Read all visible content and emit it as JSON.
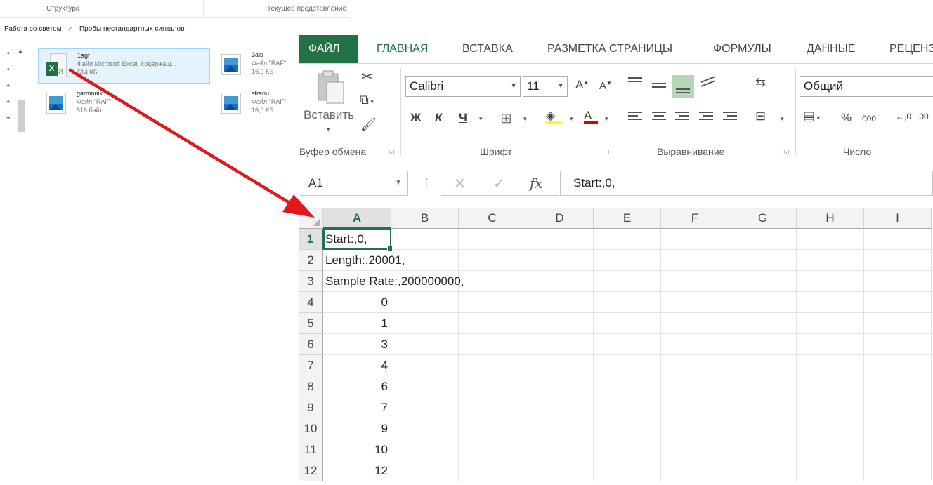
{
  "explorer": {
    "header": {
      "col1": "Структура",
      "col2": "Текущее представление"
    },
    "breadcrumb": [
      "Работа со светом",
      "Пробы нестандартных сигналов"
    ],
    "files": [
      {
        "name": "1agf",
        "type": "Файл Microsoft Excel, содержащ...",
        "size": "514 КБ",
        "icon": "excel-file-icon"
      },
      {
        "name": "3ais",
        "type": "Файл \"RAF\"",
        "size": "16,0 КБ",
        "icon": "image-file-icon"
      },
      {
        "name": "garmonik",
        "type": "Файл \"RAF\"",
        "size": "516 байт",
        "icon": "image-file-icon"
      },
      {
        "name": "stranu",
        "type": "Файл \"RAF\"",
        "size": "16,0 КБ",
        "icon": "image-file-icon"
      }
    ]
  },
  "excel": {
    "tabs": [
      "ФАЙЛ",
      "ГЛАВНАЯ",
      "ВСТАВКА",
      "РАЗМЕТКА СТРАНИЦЫ",
      "ФОРМУЛЫ",
      "ДАННЫЕ",
      "РЕЦЕНЗ"
    ],
    "ribbon": {
      "clipboard": {
        "label": "Буфер обмена",
        "paste": "Вставить"
      },
      "font": {
        "label": "Шрифт",
        "name": "Calibri",
        "size": "11",
        "bold": "Ж",
        "italic": "К",
        "underline": "Ч"
      },
      "alignment": {
        "label": "Выравнивание"
      },
      "number": {
        "label": "Число",
        "format": "Общий",
        "percent": "%",
        "thousands": "000"
      }
    },
    "name_box": "A1",
    "formula": "Start:,0,",
    "fx": "fx",
    "columns": [
      "A",
      "B",
      "C",
      "D",
      "E",
      "F",
      "G",
      "H",
      "I"
    ],
    "rows": [
      {
        "n": "1",
        "a": "Start:,0,",
        "kind": "text"
      },
      {
        "n": "2",
        "a": "Length:,20001,",
        "kind": "text"
      },
      {
        "n": "3",
        "a": "Sample Rate:,200000000,",
        "kind": "text"
      },
      {
        "n": "4",
        "a": "0",
        "kind": "num"
      },
      {
        "n": "5",
        "a": "1",
        "kind": "num"
      },
      {
        "n": "6",
        "a": "3",
        "kind": "num"
      },
      {
        "n": "7",
        "a": "4",
        "kind": "num"
      },
      {
        "n": "8",
        "a": "6",
        "kind": "num"
      },
      {
        "n": "9",
        "a": "7",
        "kind": "num"
      },
      {
        "n": "10",
        "a": "9",
        "kind": "num"
      },
      {
        "n": "11",
        "a": "10",
        "kind": "num"
      },
      {
        "n": "12",
        "a": "12",
        "kind": "num"
      }
    ],
    "active_cell": "A1"
  },
  "colors": {
    "excel_green": "#217346",
    "arrow_red": "#e0181b",
    "selection_blue": "#e5f3ff"
  }
}
